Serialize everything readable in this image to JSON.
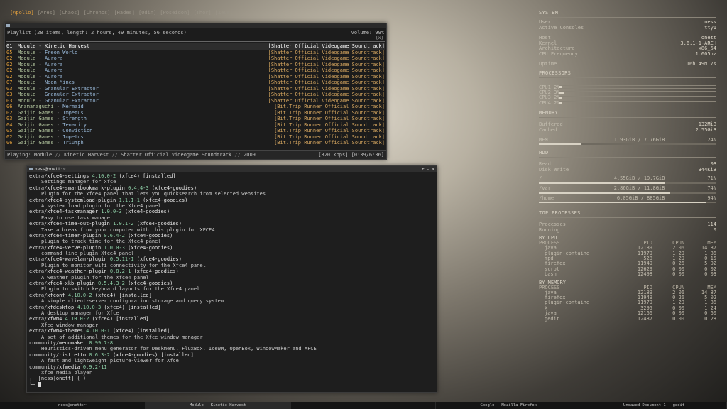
{
  "workspaces": [
    "[Apollo]",
    "[Ares]",
    "[Chaos]",
    "[Chronos]",
    "[Hades]",
    "[Odin]",
    "[Poseidon]",
    "[Thor]",
    "[Zeus]"
  ],
  "playlist": {
    "header": "Playlist (28 items, length: 2 hours, 49 minutes, 56 seconds)",
    "volume": "Volume: 99%",
    "close": "[x]",
    "rows": [
      {
        "num": "01",
        "artist": "Module",
        "title": "Kinetic Harvest",
        "album": "[Shatter Official Videogame Soundtrack]",
        "selected": true
      },
      {
        "num": "05",
        "artist": "Module",
        "title": "Freon World",
        "album": "[Shatter Official Videogame Soundtrack]"
      },
      {
        "num": "02",
        "artist": "Module",
        "title": "Aurora",
        "album": "[Shatter Official Videogame Soundtrack]"
      },
      {
        "num": "02",
        "artist": "Module",
        "title": "Aurora",
        "album": "[Shatter Official Videogame Soundtrack]"
      },
      {
        "num": "02",
        "artist": "Module",
        "title": "Aurora",
        "album": "[Shatter Official Videogame Soundtrack]"
      },
      {
        "num": "02",
        "artist": "Module",
        "title": "Aurora",
        "album": "[Shatter Official Videogame Soundtrack]"
      },
      {
        "num": "07",
        "artist": "Module",
        "title": "Neon Mines",
        "album": "[Shatter Official Videogame Soundtrack]"
      },
      {
        "num": "03",
        "artist": "Module",
        "title": "Granular Extractor",
        "album": "[Shatter Official Videogame Soundtrack]"
      },
      {
        "num": "03",
        "artist": "Module",
        "title": "Granular Extractor",
        "album": "[Shatter Official Videogame Soundtrack]"
      },
      {
        "num": "03",
        "artist": "Module",
        "title": "Granular Extractor",
        "album": "[Shatter Official Videogame Soundtrack]"
      },
      {
        "num": "06",
        "artist": "Anamanaguchi",
        "title": "Mermaid",
        "album": "[Bit.Trip Runner Official Soundtrack]"
      },
      {
        "num": "02",
        "artist": "Gaijin Games",
        "title": "Impetus",
        "album": "[Bit.Trip Runner Official Soundtrack]"
      },
      {
        "num": "03",
        "artist": "Gaijin Games",
        "title": "Strength",
        "album": "[Bit.Trip Runner Official Soundtrack]"
      },
      {
        "num": "04",
        "artist": "Gaijin Games",
        "title": "Tenacity",
        "album": "[Bit.Trip Runner Official Soundtrack]"
      },
      {
        "num": "05",
        "artist": "Gaijin Games",
        "title": "Conviction",
        "album": "[Bit.Trip Runner Official Soundtrack]"
      },
      {
        "num": "02",
        "artist": "Gaijin Games",
        "title": "Impetus",
        "album": "[Bit.Trip Runner Official Soundtrack]"
      },
      {
        "num": "06",
        "artist": "Gaijin Games",
        "title": "Triumph",
        "album": "[Bit.Trip Runner Official Soundtrack]"
      }
    ],
    "status": {
      "playing_label": "Playing:",
      "artist": "Module",
      "title": "Kinetic Harvest",
      "album": "Shatter Official Videogame Soundtrack",
      "year": "2009",
      "info": "[320 kbps] [0:39/6:36]"
    }
  },
  "terminal": {
    "title": "ness@onett:~",
    "controls": "+ - x",
    "lines": [
      {
        "t": "pkg",
        "repo": "extra/",
        "name": "xfce4-settings",
        "ver": "4.10.0-2",
        "rest": "(xfce4) [installed]"
      },
      {
        "t": "desc",
        "text": "Settings manager for xfce"
      },
      {
        "t": "pkg",
        "repo": "extra/",
        "name": "xfce4-smartbookmark-plugin",
        "ver": "0.4.4-3",
        "rest": "(xfce4-goodies)"
      },
      {
        "t": "desc",
        "text": "Plugin for the xfce4 panel that lets you quicksearch from selected websites"
      },
      {
        "t": "pkg",
        "repo": "extra/",
        "name": "xfce4-systemload-plugin",
        "ver": "1.1.1-1",
        "rest": "(xfce4-goodies)"
      },
      {
        "t": "desc",
        "text": "A system load plugin for the Xfce4 panel"
      },
      {
        "t": "pkg",
        "repo": "extra/",
        "name": "xfce4-taskmanager",
        "ver": "1.0.0-3",
        "rest": "(xfce4-goodies)"
      },
      {
        "t": "desc",
        "text": "Easy to use task manager"
      },
      {
        "t": "pkg",
        "repo": "extra/",
        "name": "xfce4-time-out-plugin",
        "ver": "1.0.1-2",
        "rest": "(xfce4-goodies)"
      },
      {
        "t": "desc",
        "text": "Take a break from your computer with this plugin for XFCE4."
      },
      {
        "t": "pkg",
        "repo": "extra/",
        "name": "xfce4-timer-plugin",
        "ver": "0.6.4-2",
        "rest": "(xfce4-goodies)"
      },
      {
        "t": "desc",
        "text": "plugin to track time for the Xfce4 panel"
      },
      {
        "t": "pkg",
        "repo": "extra/",
        "name": "xfce4-verve-plugin",
        "ver": "1.0.0-3",
        "rest": "(xfce4-goodies)"
      },
      {
        "t": "desc",
        "text": "command line plugin Xfce4 panel"
      },
      {
        "t": "pkg",
        "repo": "extra/",
        "name": "xfce4-wavelan-plugin",
        "ver": "0.5.11-1",
        "rest": "(xfce4-goodies)"
      },
      {
        "t": "desc",
        "text": "Plugin to monitor wifi connectivity for the Xfce4 panel"
      },
      {
        "t": "pkg",
        "repo": "extra/",
        "name": "xfce4-weather-plugin",
        "ver": "0.8.2-1",
        "rest": "(xfce4-goodies)"
      },
      {
        "t": "desc",
        "text": "A weather plugin for the Xfce4 panel"
      },
      {
        "t": "pkg",
        "repo": "extra/",
        "name": "xfce4-xkb-plugin",
        "ver": "0.5.4.3-2",
        "rest": "(xfce4-goodies)"
      },
      {
        "t": "desc",
        "text": "Plugin to switch keyboard layouts for the Xfce4 panel"
      },
      {
        "t": "pkg",
        "repo": "extra/",
        "name": "xfconf",
        "ver": "4.10.0-2",
        "rest": "(xfce4) [installed]"
      },
      {
        "t": "desc",
        "text": "A simple client-server configuration storage and query system"
      },
      {
        "t": "pkg",
        "repo": "extra/",
        "name": "xfdesktop",
        "ver": "4.10.0-3",
        "rest": "(xfce4) [installed]"
      },
      {
        "t": "desc",
        "text": "A desktop manager for Xfce"
      },
      {
        "t": "pkg",
        "repo": "extra/",
        "name": "xfwm4",
        "ver": "4.10.0-2",
        "rest": "(xfce4) [installed]"
      },
      {
        "t": "desc",
        "text": "Xfce window manager"
      },
      {
        "t": "pkg",
        "repo": "extra/",
        "name": "xfwm4-themes",
        "ver": "4.10.0-1",
        "rest": "(xfce4) [installed]"
      },
      {
        "t": "desc",
        "text": "A set of additional themes for the Xfce window manager"
      },
      {
        "t": "pkg",
        "repo": "community/",
        "name": "menumaker",
        "ver": "0.99.7-8",
        "rest": ""
      },
      {
        "t": "desc",
        "text": "Heuristics-driven menu generator for Deskmenu, FluxBox, IceWM, OpenBox, WindowMaker and XFCE"
      },
      {
        "t": "pkg",
        "repo": "community/",
        "name": "ristretto",
        "ver": "0.6.3-2",
        "rest": "(xfce4-goodies) [installed]"
      },
      {
        "t": "desc",
        "text": "A fast and lightweight picture-viewer for Xfce"
      },
      {
        "t": "pkg",
        "repo": "community/",
        "name": "xfmedia",
        "ver": "0.9.2-11",
        "rest": ""
      },
      {
        "t": "desc",
        "text": "xfce media player"
      }
    ],
    "prompt": "┌─ [ness|onett] (~)",
    "prompt2": "└─"
  },
  "conky": {
    "system": {
      "title": "SYSTEM",
      "rows1": [
        {
          "k": "User",
          "v": "ness"
        },
        {
          "k": "Active Consoles",
          "v": "tty1"
        }
      ],
      "rows2": [
        {
          "k": "Host",
          "v": "onett"
        },
        {
          "k": "Kernel",
          "v": "3.6.1-1-ARCH"
        },
        {
          "k": "Architecture",
          "v": "x86_64"
        },
        {
          "k": "CPU Frequency",
          "v": "1.605hz"
        }
      ],
      "uptime_k": "Uptime",
      "uptime_v": "16h 49m 7s"
    },
    "processors": {
      "title": "PROCESSORS",
      "cpus": [
        {
          "l": "CPU1",
          "p": "2%",
          "v": 2
        },
        {
          "l": "CPU2",
          "p": "3%",
          "v": 3
        },
        {
          "l": "CPU3",
          "p": "2%",
          "v": 2
        },
        {
          "l": "CPU4",
          "p": "2%",
          "v": 2
        }
      ]
    },
    "memory": {
      "title": "MEMORY",
      "rows": [
        {
          "k": "Buffered",
          "v": "132MiB"
        },
        {
          "k": "Cached",
          "v": "2.55GiB"
        }
      ],
      "mem_label": "MEM",
      "mem_val": "1.93GiB / 7.76GiB",
      "mem_pct": "24%",
      "mem_level": 24
    },
    "hdd": {
      "title": "HDD",
      "rows": [
        {
          "k": "Read",
          "v": "0B"
        },
        {
          "k": "Disk Write",
          "v": "344KiB"
        }
      ],
      "fs": [
        {
          "n": "/",
          "val": "4.55GiB / 19.7GiB",
          "pct": "71%",
          "level": 71
        },
        {
          "n": "/var",
          "val": "2.86GiB / 11.8GiB",
          "pct": "74%",
          "level": 74
        },
        {
          "n": "/home",
          "val": "6.05GiB / 885GiB",
          "pct": "94%",
          "level": 94
        }
      ]
    },
    "top": {
      "title": "TOP PROCESSES",
      "rows": [
        {
          "k": "Processes",
          "v": "114"
        },
        {
          "k": "Running",
          "v": "0"
        }
      ],
      "by_cpu_title": "BY CPU",
      "by_mem_title": "BY MEMORY",
      "headers": [
        "PROCESS",
        "PID",
        "CPU%",
        "MEM"
      ],
      "by_cpu": [
        [
          "java",
          "12189",
          "2.06",
          "14.87"
        ],
        [
          "plugin-containe",
          "11979",
          "1.29",
          "1.86"
        ],
        [
          "mpd",
          "528",
          "1.29",
          "0.15"
        ],
        [
          "firefox",
          "11949",
          "0.26",
          "5.02"
        ],
        [
          "scrot",
          "12629",
          "0.00",
          "0.02"
        ],
        [
          "bash",
          "12498",
          "0.00",
          "0.03"
        ]
      ],
      "by_mem": [
        [
          "java",
          "12189",
          "2.06",
          "14.87"
        ],
        [
          "firefox",
          "11949",
          "0.26",
          "5.02"
        ],
        [
          "plugin-containe",
          "11979",
          "1.29",
          "1.86"
        ],
        [
          "X",
          "3295",
          "0.00",
          "1.24"
        ],
        [
          "java",
          "12166",
          "0.00",
          "0.60"
        ],
        [
          "gedit",
          "12487",
          "0.00",
          "0.28"
        ]
      ]
    }
  },
  "taskbar": [
    "ness@onett:~",
    "Module - Kinetic Harvest",
    "",
    "Google - Mozilla Firefox",
    "Unsaved Document 1 - gedit"
  ]
}
